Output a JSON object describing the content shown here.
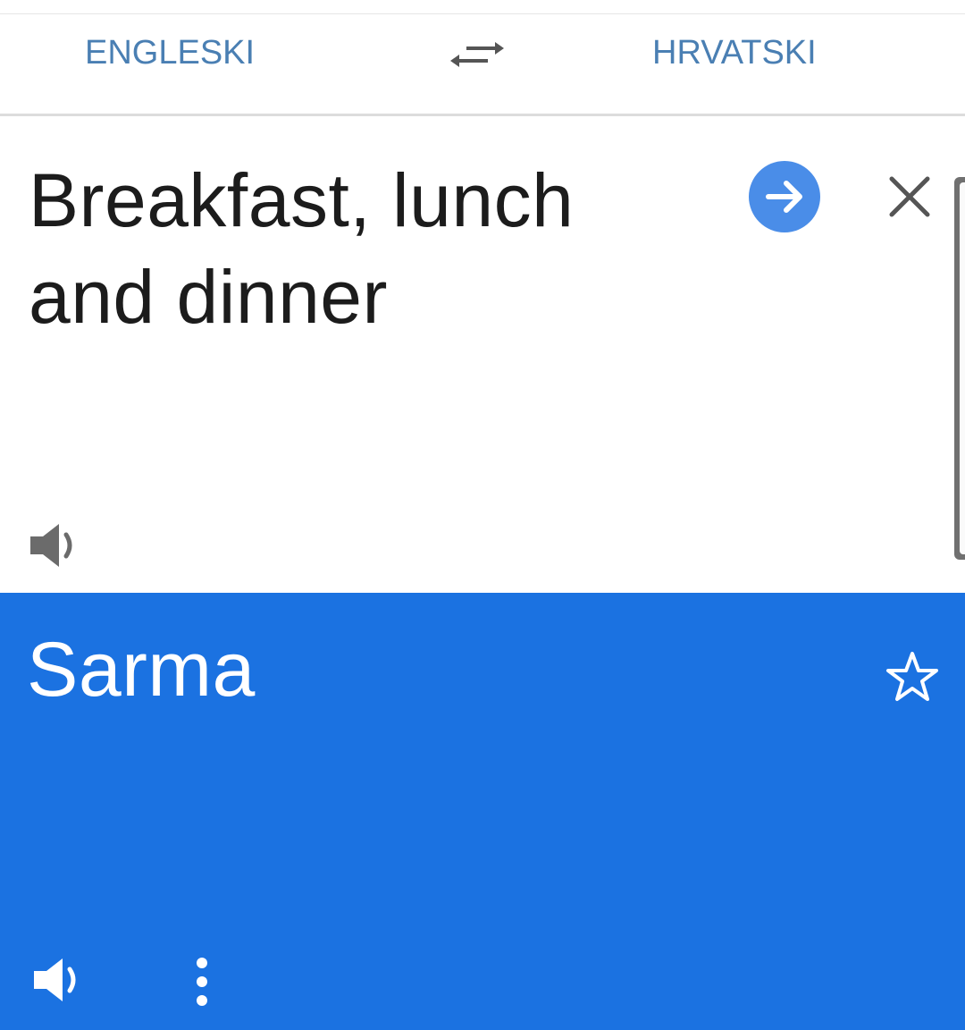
{
  "languages": {
    "source": "ENGLESKI",
    "target": "HRVATSKI"
  },
  "input": {
    "text": "Breakfast, lunch and dinner"
  },
  "result": {
    "text": "Sarma"
  },
  "icons": {
    "swap": "swap-arrows-icon",
    "go": "arrow-right-circle-icon",
    "clear": "close-icon",
    "source_speaker": "speaker-icon",
    "star": "star-outline-icon",
    "result_speaker": "speaker-icon",
    "more": "more-vert-icon"
  },
  "colors": {
    "language_label": "#4a7fb3",
    "result_background": "#1b72e1",
    "go_button": "#4a8de8",
    "icon_gray": "#6b6b6b"
  }
}
